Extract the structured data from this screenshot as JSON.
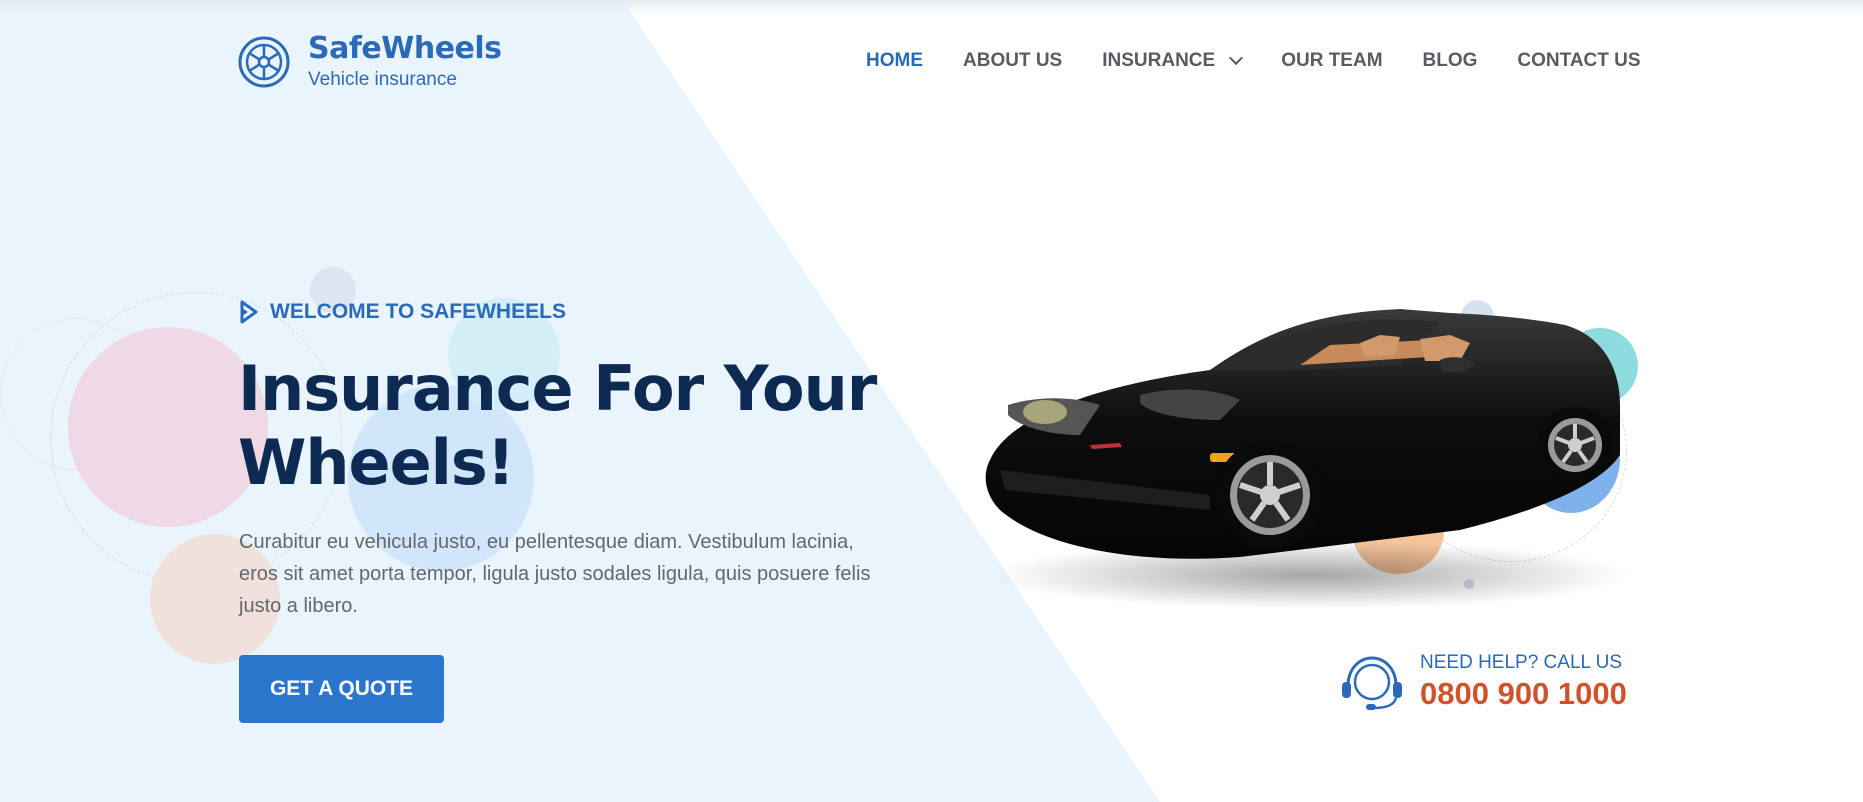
{
  "header": {
    "brand_name": "SafeWheels",
    "tagline": "Vehicle insurance",
    "logo_icon": "wheel-icon"
  },
  "nav": {
    "items": [
      {
        "label": "HOME",
        "active": true
      },
      {
        "label": "ABOUT US",
        "active": false
      },
      {
        "label": "INSURANCE",
        "active": false,
        "has_dropdown": true
      },
      {
        "label": "OUR TEAM",
        "active": false
      },
      {
        "label": "BLOG",
        "active": false
      },
      {
        "label": "CONTACT US",
        "active": false
      }
    ]
  },
  "hero": {
    "eyebrow": "WELCOME TO SAFEWHEELS",
    "headline_line1": "Insurance For Your",
    "headline_line2": "Wheels!",
    "description": "Curabitur eu vehicula justo, eu pellentesque diam. Vestibulum lacinia, eros sit amet porta tempor, ligula justo sodales ligula, quis posuere felis justo a libero.",
    "cta_label": "GET A QUOTE"
  },
  "help": {
    "label": "NEED HELP? CALL US",
    "phone": "0800 900 1000",
    "icon": "headset-icon"
  },
  "colors": {
    "brand_blue": "#2a6ab8",
    "button_blue": "#2a76cc",
    "headline_navy": "#0d2a52",
    "phone_orange": "#d2512a",
    "hero_bg": "#eaf4fd"
  }
}
